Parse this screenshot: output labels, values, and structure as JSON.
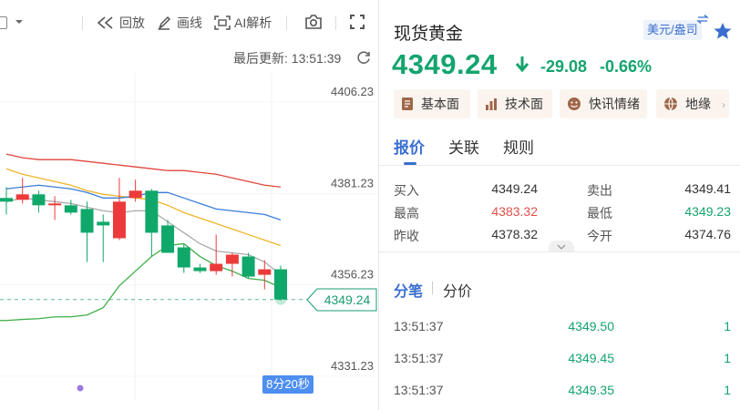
{
  "toolbar": {
    "replay_label": "回放",
    "draw_label": "画线",
    "ai_label": "AI解析",
    "last_update_label": "最后更新: 13:51:39"
  },
  "chart_data": {
    "type": "candlestick",
    "y_ticks": [
      "4406.23",
      "4381.23",
      "4356.23",
      "4331.23"
    ],
    "ylim": [
      4325.73,
      4411.73
    ],
    "current_price_label": "4349.24",
    "current_price": 4349.24,
    "countdown_label": "8分20秒",
    "candles": [
      {
        "o": 4377.0,
        "h": 4380.0,
        "l": 4372.5,
        "c": 4376.0
      },
      {
        "o": 4376.5,
        "h": 4382.5,
        "l": 4375.5,
        "c": 4378.0
      },
      {
        "o": 4378.0,
        "h": 4379.0,
        "l": 4373.0,
        "c": 4375.0
      },
      {
        "o": 4375.0,
        "h": 4377.5,
        "l": 4371.0,
        "c": 4375.5
      },
      {
        "o": 4375.0,
        "h": 4376.5,
        "l": 4372.5,
        "c": 4373.0
      },
      {
        "o": 4374.0,
        "h": 4376.0,
        "l": 4359.5,
        "c": 4367.5
      },
      {
        "o": 4370.5,
        "h": 4372.5,
        "l": 4359.5,
        "c": 4369.5
      },
      {
        "o": 4366.0,
        "h": 4382.5,
        "l": 4365.5,
        "c": 4376.0
      },
      {
        "o": 4377.0,
        "h": 4382.0,
        "l": 4376.0,
        "c": 4379.0
      },
      {
        "o": 4379.0,
        "h": 4379.5,
        "l": 4361.0,
        "c": 4367.5
      },
      {
        "o": 4369.5,
        "h": 4371.0,
        "l": 4362.0,
        "c": 4362.0
      },
      {
        "o": 4363.5,
        "h": 4364.5,
        "l": 4356.5,
        "c": 4358.0
      },
      {
        "o": 4358.0,
        "h": 4359.0,
        "l": 4356.5,
        "c": 4357.0
      },
      {
        "o": 4357.0,
        "h": 4367.0,
        "l": 4356.0,
        "c": 4359.0
      },
      {
        "o": 4359.0,
        "h": 4362.0,
        "l": 4355.5,
        "c": 4361.5
      },
      {
        "o": 4361.0,
        "h": 4362.0,
        "l": 4355.0,
        "c": 4355.5
      },
      {
        "o": 4356.0,
        "h": 4360.0,
        "l": 4352.0,
        "c": 4357.5
      },
      {
        "o": 4357.5,
        "h": 4358.5,
        "l": 4349.0,
        "c": 4349.24
      }
    ],
    "overlays": [
      {
        "color": "#e0463c",
        "y": [
          4389.0,
          4388.0,
          4387.5,
          4387.5,
          4387.5,
          4387.0,
          4386.5,
          4386.0,
          4385.5,
          4385.0,
          4384.5,
          4384.5,
          4384.0,
          4383.5,
          4382.5,
          4381.5,
          4380.5,
          4380.0
        ]
      },
      {
        "color": "#f0b429",
        "y": [
          4385.0,
          4383.5,
          4382.5,
          4381.5,
          4380.5,
          4379.0,
          4378.0,
          4377.5,
          4377.0,
          4376.5,
          4375.0,
          4373.0,
          4371.5,
          4370.0,
          4368.5,
          4367.0,
          4365.5,
          4364.0
        ]
      },
      {
        "color": "#3b7dd8",
        "y": [
          4379.5,
          4380.0,
          4380.5,
          4380.0,
          4379.5,
          4378.5,
          4377.0,
          4377.0,
          4377.5,
          4378.5,
          4378.5,
          4377.0,
          4375.5,
          4374.0,
          4373.5,
          4373.0,
          4372.5,
          4371.0
        ]
      },
      {
        "color": "#aaaaaa",
        "y": [
          4376.0,
          4377.0,
          4376.5,
          4376.0,
          4375.5,
          4374.5,
          4373.5,
          4373.0,
          4373.5,
          4373.5,
          4370.5,
          4367.5,
          4364.5,
          4362.5,
          4362.0,
          4361.5,
          4359.5,
          4356.0
        ]
      },
      {
        "color": "#3fae49",
        "y": [
          4343.5,
          4343.8,
          4344.0,
          4344.5,
          4344.5,
          4345.0,
          4347.0,
          4353.0,
          4357.0,
          4361.0,
          4364.0,
          4364.5,
          4361.0,
          4358.5,
          4357.0,
          4355.0,
          4354.5,
          4352.5
        ]
      }
    ]
  },
  "quote": {
    "title": "现货黄金",
    "currency": "美元/盎司",
    "price": "4349.24",
    "change": "-29.08",
    "change_pct": "-0.66%",
    "chips": [
      "基本面",
      "技术面",
      "快讯情绪",
      "地缘"
    ],
    "tabs": [
      "报价",
      "关联",
      "规则"
    ],
    "rows": [
      [
        {
          "label": "买入",
          "value": "4349.24"
        },
        {
          "label": "卖出",
          "value": "4349.41"
        }
      ],
      [
        {
          "label": "最高",
          "value": "4383.32"
        },
        {
          "label": "最低",
          "value": "4349.23"
        }
      ],
      [
        {
          "label": "昨收",
          "value": "4378.32"
        },
        {
          "label": "今开",
          "value": "4374.76"
        }
      ]
    ],
    "sub_tabs": [
      "分笔",
      "分价"
    ],
    "ticks": [
      {
        "time": "13:51:37",
        "price": "4349.50",
        "vol": "1"
      },
      {
        "time": "13:51:37",
        "price": "4349.45",
        "vol": "1"
      },
      {
        "time": "13:51:37",
        "price": "4349.35",
        "vol": "1"
      }
    ]
  }
}
